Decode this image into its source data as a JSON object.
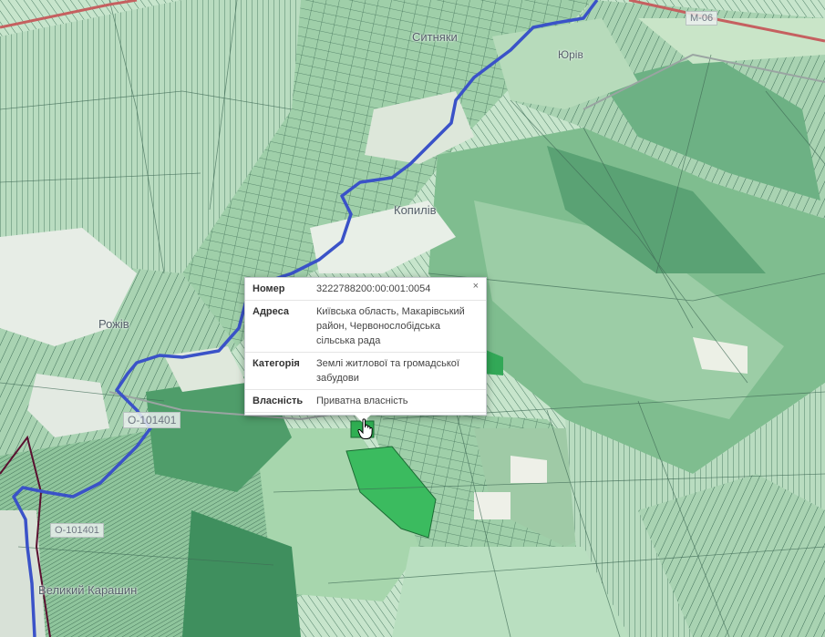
{
  "map": {
    "places": [
      {
        "name": "Ситняки"
      },
      {
        "name": "Юрів"
      },
      {
        "name": "Копилів"
      },
      {
        "name": "Рожів"
      },
      {
        "name": "Великий Карашин"
      }
    ],
    "road_badges": [
      "М-06",
      "О-101401",
      "О-101401"
    ],
    "colors": {
      "background": "#cfe3d3",
      "parcel_dark": "#4d9c6d",
      "parcel_mid": "#8cc49a",
      "parcel_light": "#c8e3c8",
      "river": "#3a52c8",
      "road": "#c56060",
      "boundary": "#5a1030",
      "selected_parcel": "#36b45a"
    }
  },
  "popup": {
    "close_label": "×",
    "rows": [
      {
        "key": "Номер",
        "value": "3222788200:00:001:0054"
      },
      {
        "key": "Адреса",
        "value": "Київська область, Макарівський район, Червонослобідська сільська рада"
      },
      {
        "key": "Категорія",
        "value": "Землі житлової та громадської забудови"
      },
      {
        "key": "Власність",
        "value": "Приватна власність"
      }
    ]
  }
}
